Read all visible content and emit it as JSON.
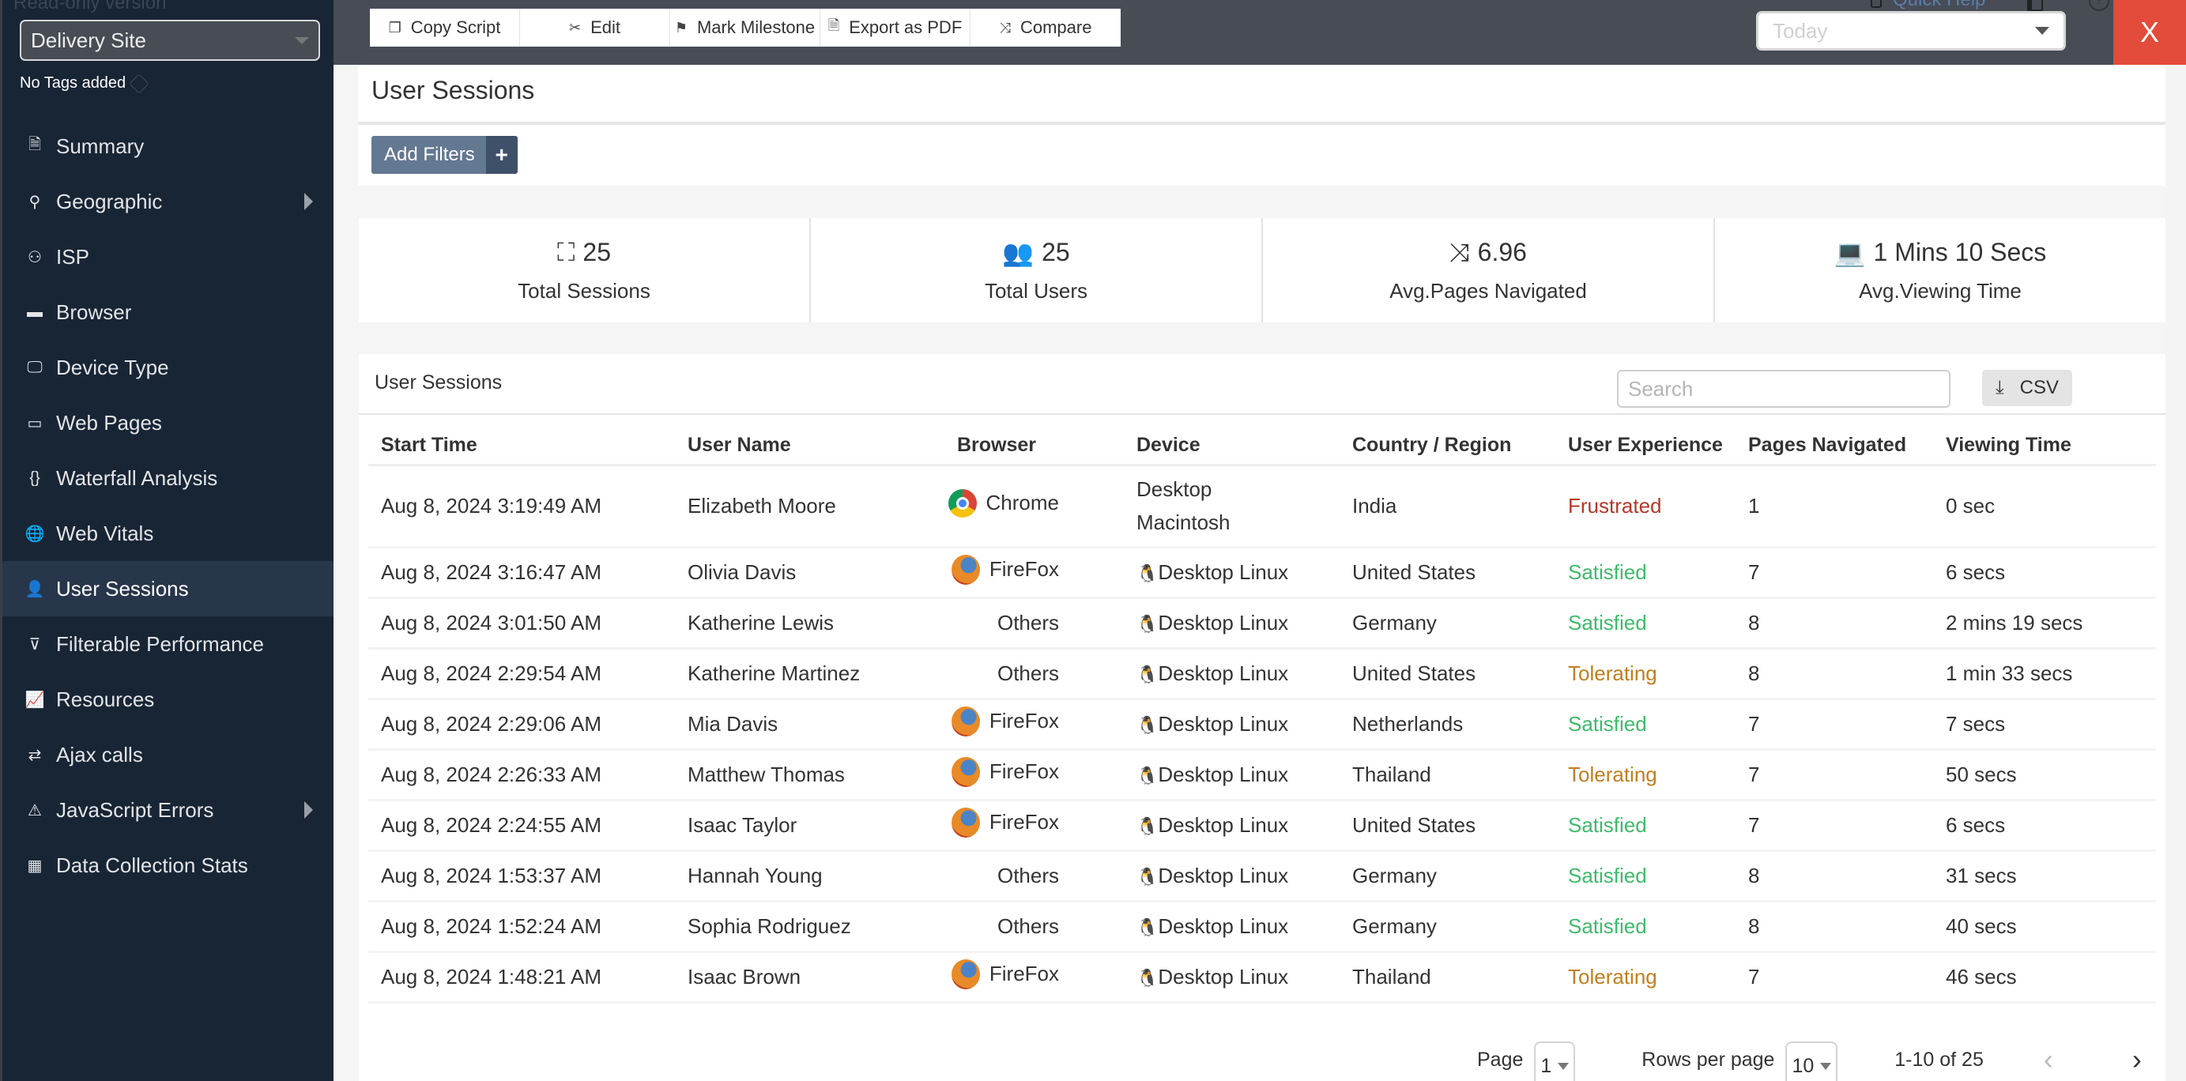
{
  "sidebar": {
    "readonly_label": "Read-only version",
    "site_select": "Delivery Site",
    "tags_label": "No Tags added",
    "items": [
      {
        "label": "Summary",
        "icon": "document-icon",
        "glyph": "🗎",
        "submenu": false,
        "active": false
      },
      {
        "label": "Geographic",
        "icon": "map-pin-icon",
        "glyph": "⚲",
        "submenu": true,
        "active": false
      },
      {
        "label": "ISP",
        "icon": "isp-user-icon",
        "glyph": "⚇",
        "submenu": false,
        "active": false
      },
      {
        "label": "Browser",
        "icon": "browser-window-icon",
        "glyph": "▬",
        "submenu": false,
        "active": false
      },
      {
        "label": "Device Type",
        "icon": "monitor-icon",
        "glyph": "🖵",
        "submenu": false,
        "active": false
      },
      {
        "label": "Web Pages",
        "icon": "web-page-icon",
        "glyph": "▭",
        "submenu": false,
        "active": false
      },
      {
        "label": "Waterfall Analysis",
        "icon": "code-brackets-icon",
        "glyph": "{}",
        "submenu": false,
        "active": false
      },
      {
        "label": "Web Vitals",
        "icon": "globe-icon",
        "glyph": "🌐",
        "submenu": false,
        "active": false
      },
      {
        "label": "User Sessions",
        "icon": "user-icon",
        "glyph": "👤",
        "submenu": false,
        "active": true
      },
      {
        "label": "Filterable Performance",
        "icon": "filter-icon",
        "glyph": "⊽",
        "submenu": false,
        "active": false
      },
      {
        "label": "Resources",
        "icon": "resources-chart-icon",
        "glyph": "📈",
        "submenu": false,
        "active": false
      },
      {
        "label": "Ajax calls",
        "icon": "refresh-arrows-icon",
        "glyph": "⇄",
        "submenu": false,
        "active": false
      },
      {
        "label": "JavaScript Errors",
        "icon": "warning-triangle-icon",
        "glyph": "⚠",
        "submenu": true,
        "active": false
      },
      {
        "label": "Data Collection Stats",
        "icon": "table-grid-icon",
        "glyph": "▦",
        "submenu": false,
        "active": false
      }
    ]
  },
  "toolbar": {
    "buttons": [
      {
        "label": "Copy Script",
        "icon": "copy-icon",
        "glyph": "❐"
      },
      {
        "label": "Edit",
        "icon": "tools-icon",
        "glyph": "✂"
      },
      {
        "label": "Mark Milestone",
        "icon": "flag-icon",
        "glyph": "⚑"
      },
      {
        "label": "Export as PDF",
        "icon": "pdf-icon",
        "glyph": "🗎"
      },
      {
        "label": "Compare",
        "icon": "shuffle-icon",
        "glyph": "⤨"
      }
    ],
    "quick_help": "Quick Help",
    "date_range": "Today",
    "close_label": "X"
  },
  "page": {
    "title": "User Sessions",
    "add_filters": "Add Filters",
    "add_filters_plus": "+"
  },
  "stats": [
    {
      "value": "25",
      "label": "Total Sessions",
      "icon": "presentation-play-icon",
      "glyph": "⛶"
    },
    {
      "value": "25",
      "label": "Total Users",
      "icon": "users-group-icon",
      "glyph": "👥"
    },
    {
      "value": "6.96",
      "label": "Avg.Pages Navigated",
      "icon": "shuffle-icon",
      "glyph": "⤨"
    },
    {
      "value": "1 Mins 10 Secs",
      "label": "Avg.Viewing Time",
      "icon": "user-laptop-icon",
      "glyph": "💻"
    }
  ],
  "table": {
    "title": "User Sessions",
    "search_placeholder": "Search",
    "csv_label": "CSV",
    "columns": [
      "Start Time",
      "User Name",
      "Browser",
      "Device",
      "Country / Region",
      "User Experience",
      "Pages Navigated",
      "Viewing Time"
    ],
    "rows": [
      {
        "start": "Aug 8, 2024 3:19:49 AM",
        "user": "Elizabeth Moore",
        "browser": "Chrome",
        "os": "apple",
        "device": "Desktop Macintosh",
        "country": "India",
        "experience": "Frustrated",
        "pages": "1",
        "viewing": "0 sec"
      },
      {
        "start": "Aug 8, 2024 3:16:47 AM",
        "user": "Olivia Davis",
        "browser": "FireFox",
        "os": "linux",
        "device": "Desktop Linux",
        "country": "United States",
        "experience": "Satisfied",
        "pages": "7",
        "viewing": "6 secs"
      },
      {
        "start": "Aug 8, 2024 3:01:50 AM",
        "user": "Katherine Lewis",
        "browser": "Others",
        "os": "linux",
        "device": "Desktop Linux",
        "country": "Germany",
        "experience": "Satisfied",
        "pages": "8",
        "viewing": "2 mins 19 secs"
      },
      {
        "start": "Aug 8, 2024 2:29:54 AM",
        "user": "Katherine Martinez",
        "browser": "Others",
        "os": "linux",
        "device": "Desktop Linux",
        "country": "United States",
        "experience": "Tolerating",
        "pages": "8",
        "viewing": "1 min 33 secs"
      },
      {
        "start": "Aug 8, 2024 2:29:06 AM",
        "user": "Mia Davis",
        "browser": "FireFox",
        "os": "linux",
        "device": "Desktop Linux",
        "country": "Netherlands",
        "experience": "Satisfied",
        "pages": "7",
        "viewing": "7 secs"
      },
      {
        "start": "Aug 8, 2024 2:26:33 AM",
        "user": "Matthew Thomas",
        "browser": "FireFox",
        "os": "linux",
        "device": "Desktop Linux",
        "country": "Thailand",
        "experience": "Tolerating",
        "pages": "7",
        "viewing": "50 secs"
      },
      {
        "start": "Aug 8, 2024 2:24:55 AM",
        "user": "Isaac Taylor",
        "browser": "FireFox",
        "os": "linux",
        "device": "Desktop Linux",
        "country": "United States",
        "experience": "Satisfied",
        "pages": "7",
        "viewing": "6 secs"
      },
      {
        "start": "Aug 8, 2024 1:53:37 AM",
        "user": "Hannah Young",
        "browser": "Others",
        "os": "linux",
        "device": "Desktop Linux",
        "country": "Germany",
        "experience": "Satisfied",
        "pages": "8",
        "viewing": "31 secs"
      },
      {
        "start": "Aug 8, 2024 1:52:24 AM",
        "user": "Sophia Rodriguez",
        "browser": "Others",
        "os": "linux",
        "device": "Desktop Linux",
        "country": "Germany",
        "experience": "Satisfied",
        "pages": "8",
        "viewing": "40 secs"
      },
      {
        "start": "Aug 8, 2024 1:48:21 AM",
        "user": "Isaac Brown",
        "browser": "FireFox",
        "os": "linux",
        "device": "Desktop Linux",
        "country": "Thailand",
        "experience": "Tolerating",
        "pages": "7",
        "viewing": "46 secs"
      }
    ]
  },
  "pagination": {
    "page_label": "Page",
    "page_value": "1",
    "rows_label": "Rows per page",
    "rows_value": "10",
    "range": "1-10 of 25",
    "prev": "‹",
    "next": "›"
  },
  "colors": {
    "sidebar_bg": "#182535",
    "topbar_bg": "#474c55",
    "close_bg": "#e34b3a",
    "frustrated": "#b5372a",
    "satisfied": "#3fba6c",
    "tolerating": "#c27e1e"
  }
}
